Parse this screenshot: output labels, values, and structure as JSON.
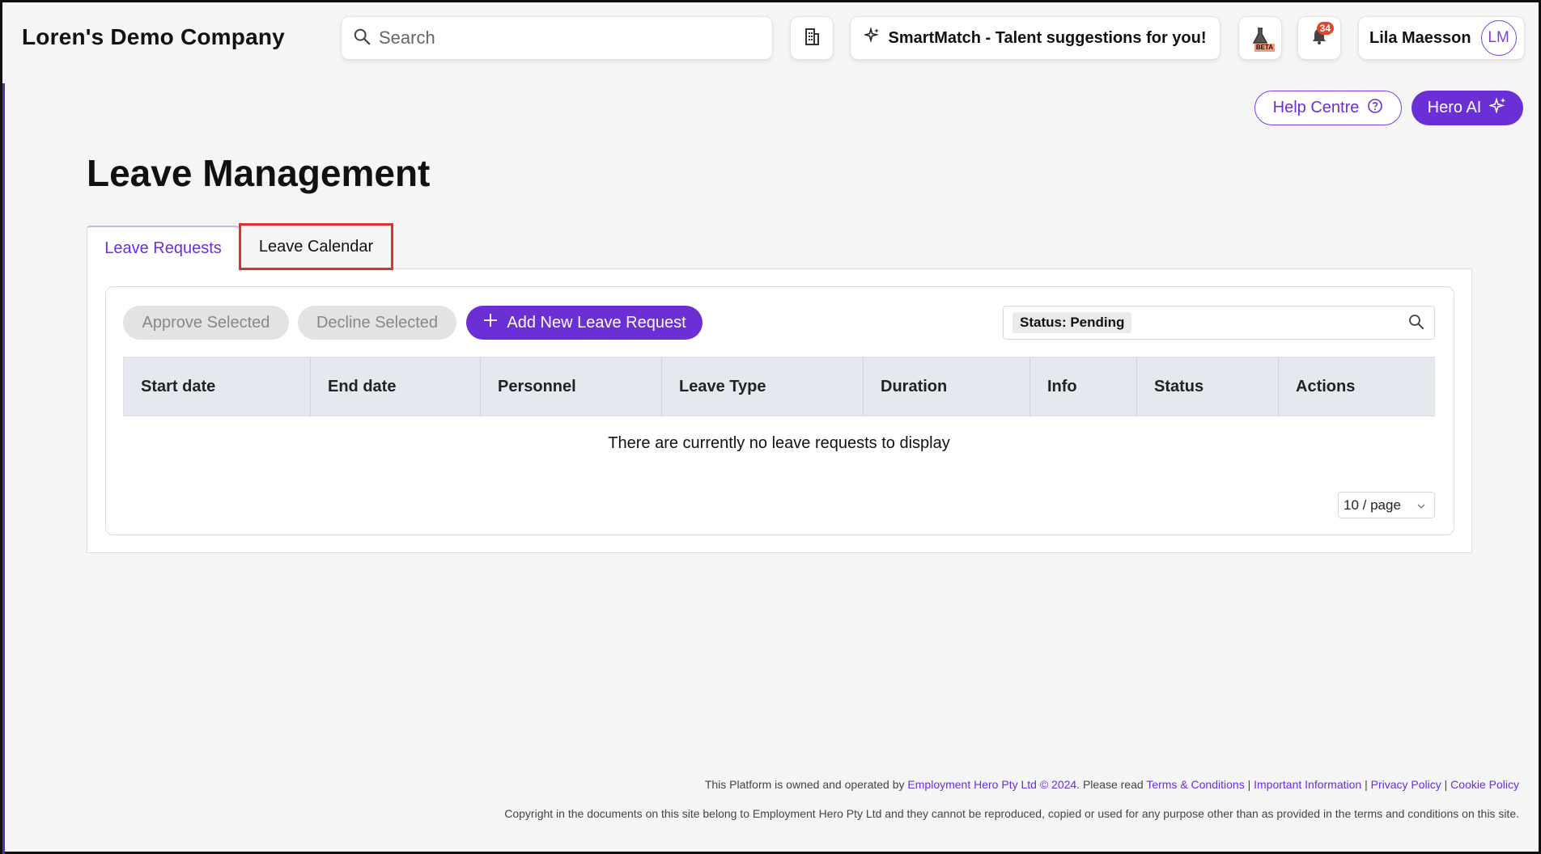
{
  "header": {
    "company": "Loren's Demo Company",
    "search_placeholder": "Search",
    "smartmatch": "SmartMatch - Talent suggestions for you!",
    "beta_label": "BETA",
    "notification_count": "34",
    "user_name": "Lila Maesson",
    "user_initials": "LM"
  },
  "actions": {
    "help_centre": "Help Centre",
    "hero_ai": "Hero AI"
  },
  "page": {
    "title": "Leave Management",
    "tabs": [
      {
        "label": "Leave Requests",
        "active": true
      },
      {
        "label": "Leave Calendar",
        "active": false
      }
    ]
  },
  "toolbar": {
    "approve": "Approve Selected",
    "decline": "Decline Selected",
    "add_new": "Add New Leave Request",
    "filter_chip": "Status: Pending"
  },
  "table": {
    "columns": [
      "Start date",
      "End date",
      "Personnel",
      "Leave Type",
      "Duration",
      "Info",
      "Status",
      "Actions"
    ],
    "empty_message": "There are currently no leave requests to display",
    "page_size": "10 / page"
  },
  "footer": {
    "line1_prefix": "This Platform is owned and operated by",
    "owner_link": "Employment Hero Pty Ltd © 2024",
    "line1_mid": ". Please read",
    "terms": "Terms & Conditions",
    "important": "Important Information",
    "privacy": "Privacy Policy",
    "cookie": "Cookie Policy",
    "copyright": "Copyright in the documents on this site belong to Employment Hero Pty Ltd and they cannot be reproduced, copied or used for any purpose other than as provided in the terms and conditions on this site."
  },
  "colors": {
    "accent": "#6b2fd6",
    "highlight_box": "#d9342b",
    "badge": "#e2462d"
  }
}
